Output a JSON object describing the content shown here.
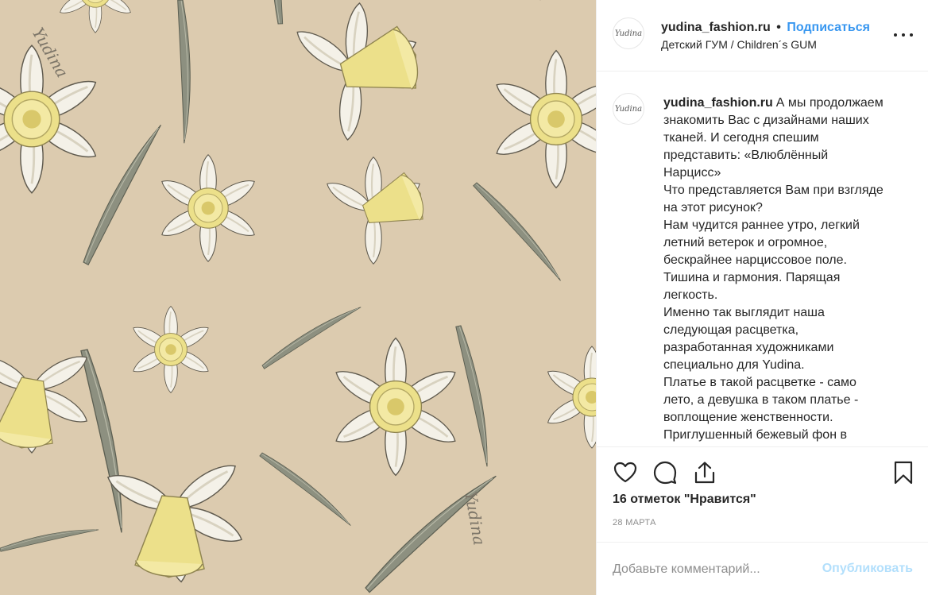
{
  "image": {
    "background_color": "#dccbaf",
    "watermark_text": "Yudina"
  },
  "header": {
    "avatar_text": "Yudina",
    "username": "yudina_fashion.ru",
    "separator": "•",
    "follow_label": "Подписаться",
    "location": "Детский ГУМ / Children´s GUM",
    "more_icon": "more-horizontal-icon"
  },
  "caption": {
    "avatar_text": "Yudina",
    "username": "yudina_fashion.ru",
    "lines": [
      "А мы продолжаем",
      "знакомить Вас с дизайнами наших",
      "тканей. И сегодня спешим",
      "представить: «Влюблённый",
      "Нарцисс»",
      "Что представляется Вам при взгляде",
      "на этот рисунок?",
      "Нам чудится раннее утро, легкий",
      "летний ветерок и огромное,",
      "бескрайнее нарциссовое поле.",
      "Тишина и гармония. Парящая",
      "легкость.",
      "Именно так выглядит наша",
      "следующая расцветка,",
      "разработанная художниками",
      "специально для Yudina.",
      "Платье в такой расцветке - само",
      "лето, а девушка в таком платье -",
      "воплощение женственности.",
      "Приглушенный бежевый фон в"
    ]
  },
  "actions": {
    "like_icon": "heart-icon",
    "comment_icon": "comment-icon",
    "share_icon": "share-icon",
    "save_icon": "bookmark-icon",
    "likes_text": "16 отметок \"Нравится\"",
    "date": "28 МАРТА"
  },
  "add_comment": {
    "placeholder": "Добавьте комментарий...",
    "publish_label": "Опубликовать"
  },
  "colors": {
    "link": "#3897f0",
    "publish_disabled": "#b2dffc",
    "muted": "#8e8e8e",
    "text": "#262626"
  }
}
